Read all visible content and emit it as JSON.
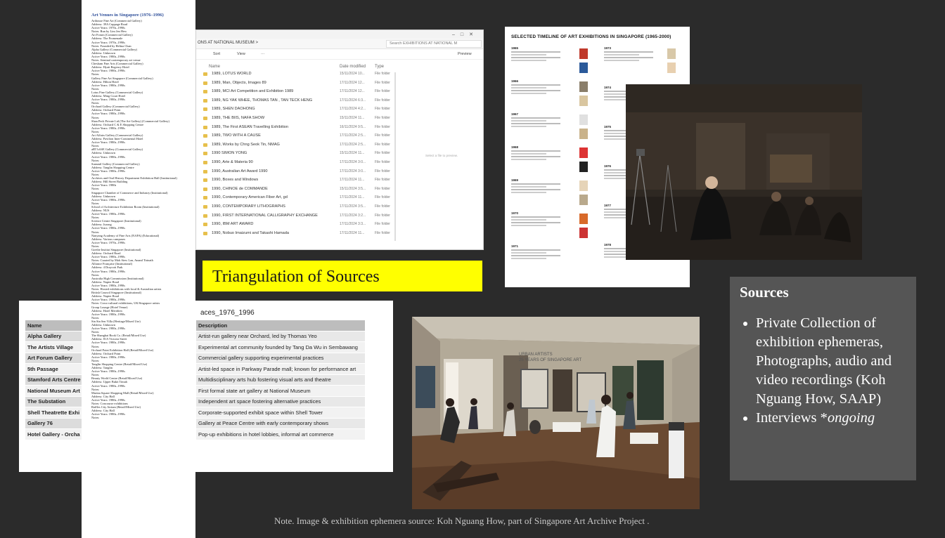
{
  "slide": {
    "banner_title": "Triangulation of Sources",
    "note": "Note. Image & exhibition ephemera source: Koh Nguang How, part of Singapore Art Archive Project ."
  },
  "sources_box": {
    "title": "Sources",
    "items": [
      "Private Collection of exhibition ephemeras, Photographs, audio and video recordings (Koh Nguang How, SAAP)",
      "Interviews *ongoing"
    ]
  },
  "venues_doc": {
    "title": "Art Venues in Singapore (1976–1996)",
    "lines": [
      "Arthouse Fine Art (Commercial Gallery)",
      "Address: 39A Cuppage Road",
      "Active Years: 1970s–1990s",
      "Notes: Run by Lim Jen Hew",
      "Art Forum (Commercial Gallery)",
      "Address: The Promenade",
      "Active Years: 1970s–1990s",
      "Notes: Founded by Helina Chan",
      "Alpha Gallery (Commercial Gallery)",
      "Address: Unknown",
      "Active Years: 1980s–1990s",
      "Notes: Seminal contemporary art venue",
      "Chesham Fine Arts (Commercial Gallery)",
      "Address: Hyatt Regency Hotel",
      "Active Years: 1980s–1990s",
      "Notes:",
      "Gallery Fine Art Singapore (Commercial Gallery)",
      "Address: Hilton Hotel",
      "Active Years: 1980s–1990s",
      "Notes:",
      "Lotus Fine Gallery (Commercial Gallery)",
      "Address: Ming Court Hotel",
      "Active Years: 1980s–1990s",
      "Notes:",
      "Orchard Gallery (Commercial Gallery)",
      "Address: Orchard Point",
      "Active Years: 1980s–1990s",
      "Notes:",
      "Shan Peck Private Ltd (The Art Gallery) (Commercial Gallery)",
      "Address: Orchard C & E Shopping Centre",
      "Active Years: 1980s–1990s",
      "Notes:",
      "Art Affairs Gallery (Commercial Gallery)",
      "Address: Pavilion Inter-Continental Hotel",
      "Active Years: 1980s–1990s",
      "Notes:",
      "aRT bASE Gallery (Commercial Gallery)",
      "Address: Unknown",
      "Active Years: 1980s–1990s",
      "Notes:",
      "Sunsmil Gallery (Commercial Gallery)",
      "Address: Tanglin Shopping Centre",
      "Active Years: 1980s–1990s",
      "Notes:",
      "Archives and Oral History Department Exhibition Hall (Institutional)",
      "Address: Hill Street Building",
      "Active Years: 1980s",
      "Notes:",
      "Singapore Chamber of Commerce and Industry (Institutional)",
      "Address: Unknown",
      "Active Years: 1980s–1990s",
      "Notes:",
      "School of Architecture Exhibition Room (Institutional)",
      "Address: NUS",
      "Active Years: 1980s–1990s",
      "Notes:",
      "Science Centre Singapore (Institutional)",
      "Address: Jurong",
      "Active Years: 1980s–1990s",
      "Notes:",
      "Nanyang Academy of Fine Arts (NAFA) (Educational)",
      "Address: Various campuses",
      "Active Years: 1970s–1990s",
      "Notes:",
      "Goethe Institut Singapore (Institutional)",
      "Address: Orchard Road",
      "Active Years: 1980s–1990s",
      "Notes: Curated by Moh Siew Lan, Anand Tirinath",
      "Alliance Française (Institutional)",
      "Address: 4 Draycott Park",
      "Active Years: 1980s–1990s",
      "Notes:",
      "Australia High Commission (Institutional)",
      "Address: Napier Road",
      "Active Years: 1980s–1990s",
      "Notes: Hosted exhibitions with local & Australian artists",
      "British Council Singapore (Institutional)",
      "Address: Napier Road",
      "Active Years: 1980s–1990s",
      "Notes: Cross-cultural exhibitions, UK/Singapore artists",
      "Group Lounge (Hotel Venue)",
      "Address: Hotel Meridien",
      "Active Years: 1980s–1990s",
      "Notes:",
      "Sin Sin Sen Villa (Heritage/Mixed Use)",
      "Address: Unknown",
      "Active Years: 1980s–1990s",
      "Notes:",
      "The Shanghai Book Co. (Retail/Mixed Use)",
      "Address: 81A Victoria Street",
      "Active Years: 1980s–1990s",
      "Notes:",
      "Orchard Point Exhibition Hall (Retail/Mixed Use)",
      "Address: Orchard Point",
      "Active Years: 1980s–1990s",
      "Notes:",
      "Tanglin Shopping Centre (Retail/Mixed Use)",
      "Address: Tanglin",
      "Active Years: 1980s–1990s",
      "Notes:",
      "Beauty World Centre (Retail/Mixed Use)",
      "Address: Upper Bukit Timah",
      "Active Years: 1980s–1990s",
      "Notes:",
      "Marina Square Shopping Mall (Retail/Mixed Use)",
      "Address: City Hall",
      "Active Years: 1980s–1990s",
      "Notes: Concourse exhibitions",
      "Raffles City Atrium (Retail/Mixed Use)",
      "Address: City Hall",
      "Active Years: 1980s–1990s",
      "Notes:"
    ]
  },
  "explorer": {
    "address": "ONS AT NATIONAL MUSEUM  >",
    "search_placeholder": "Search EXHIBITIONS AT NATIONAL M",
    "toolbar": {
      "sort": "Sort",
      "view": "View",
      "more": "···",
      "preview": "Preview"
    },
    "columns": {
      "name": "Name",
      "date": "Date modified",
      "type": "Type"
    },
    "preview_hint": "Select a file to preview.",
    "rows": [
      {
        "name": "1989, LOTUS WORLD",
        "date": "15/11/2024 10...",
        "type": "File folder"
      },
      {
        "name": "1989, Man, Objects, Images 89",
        "date": "17/11/2024 12...",
        "type": "File folder"
      },
      {
        "name": "1989, MCI Art Competition and Exhibition 1989",
        "date": "17/11/2024 12...",
        "type": "File folder"
      },
      {
        "name": "1989,  NG YAK WHEE, THOMAS TAN , TAN TECK HENG",
        "date": "17/11/2024 6:3...",
        "type": "File folder"
      },
      {
        "name": "1989, SHEN DAOHONG",
        "date": "17/11/2024 4:2...",
        "type": "File folder"
      },
      {
        "name": "1989, THE BIIS,  NAFA SHOW",
        "date": "15/11/2024 11...",
        "type": "File folder"
      },
      {
        "name": "1989, The First ASEAN Travelling Exhibition",
        "date": "16/11/2024 9:5...",
        "type": "File folder"
      },
      {
        "name": "1989, TWO WITH A CAUSE",
        "date": "17/11/2024 2:5...",
        "type": "File folder"
      },
      {
        "name": "1989, Works by Chng Seok Tin, NMAG",
        "date": "17/11/2024 2:5...",
        "type": "File folder"
      },
      {
        "name": "1990 SIMON YONG",
        "date": "15/11/2024 11...",
        "type": "File folder"
      },
      {
        "name": "1990, Arte & Materia 90",
        "date": "17/11/2024 3:0...",
        "type": "File folder"
      },
      {
        "name": "1990, Australian Art Award 1990",
        "date": "17/11/2024 3:0...",
        "type": "File folder"
      },
      {
        "name": "1990, Boxes and Windows",
        "date": "17/11/2024 11...",
        "type": "File folder"
      },
      {
        "name": "1990, CHINOE de COMMANDE",
        "date": "15/11/2024 3:5...",
        "type": "File folder"
      },
      {
        "name": "1990, Contemporary American Fiber Art, gd",
        "date": "17/11/2024 11...",
        "type": "File folder"
      },
      {
        "name": "1990, CONTEMPORARY LITHOGRAPHS",
        "date": "17/11/2024 3:5...",
        "type": "File folder"
      },
      {
        "name": "1990, FIRST INTERNATIONAL CALLIGRAPHY EXCHANGE",
        "date": "17/11/2024 3:2...",
        "type": "File folder"
      },
      {
        "name": "1990, IBM ART AWARD",
        "date": "17/11/2024 3:3...",
        "type": "File folder"
      },
      {
        "name": "1990, Nobuo Imaizumi and Takashi Hamada",
        "date": "17/11/2024 11...",
        "type": "File folder"
      }
    ]
  },
  "timeline": {
    "title": "SELECTED  TIMELINE  OF  ART  EXHIBITIONS  IN  SINGAPORE  (1965-2000)",
    "left_years": [
      "1965",
      "1966",
      "1967",
      "1968",
      "1969",
      "1970",
      "1971"
    ],
    "right_years": [
      "1973",
      "1974",
      "1975",
      "1976",
      "1977",
      "1978"
    ],
    "left_thumbs": [
      "#c0392b",
      "#2b5a9a",
      "#8a7e6a",
      "#d9c6a0",
      "#e0e0e0",
      "#c9b28a",
      "#d33",
      "#222",
      "#e6d4b8",
      "#b9a98c",
      "#d86a2a",
      "#c33"
    ],
    "right_thumbs": [
      "#d8c8a8",
      "#e8d0b0"
    ]
  },
  "table_page": {
    "title": "aces_1976_1996",
    "headers": {
      "name": "Name",
      "description": "Description"
    },
    "rows": [
      {
        "name": "Alpha Gallery",
        "description": "Artist-run gallery near Orchard, led by Thomas Yeo"
      },
      {
        "name": "The Artists Village",
        "description": "Experimental art community founded by Tang Da Wu in Sembawang"
      },
      {
        "name": "Art Forum Gallery",
        "description": "Commercial gallery supporting experimental practices"
      },
      {
        "name": "5th Passage",
        "description": "Artist-led space in Parkway Parade mall; known for performance art"
      },
      {
        "name": "Stamford Arts Centre",
        "description": "Multidisciplinary arts hub fostering visual arts and theatre"
      },
      {
        "name": "National Museum Art",
        "description": "First formal state art gallery at National Museum"
      },
      {
        "name": "The Substation",
        "description": "Independent art space fostering alternative practices"
      },
      {
        "name": "Shell Theatrette Exhi",
        "description": "Corporate-supported exhibit space within Shell Tower"
      },
      {
        "name": "Gallery 76",
        "description": "Gallery at Peace Centre with early contemporary shows"
      },
      {
        "name": "Hotel Gallery - Orcha",
        "description": "Pop-up exhibitions in hotel lobbies, informal art commerce"
      }
    ]
  },
  "gallery_photo": {
    "banner_line1": "URBAN ARTISTS",
    "banner_line2": "25 YEARS OF SINGAPORE ART"
  }
}
